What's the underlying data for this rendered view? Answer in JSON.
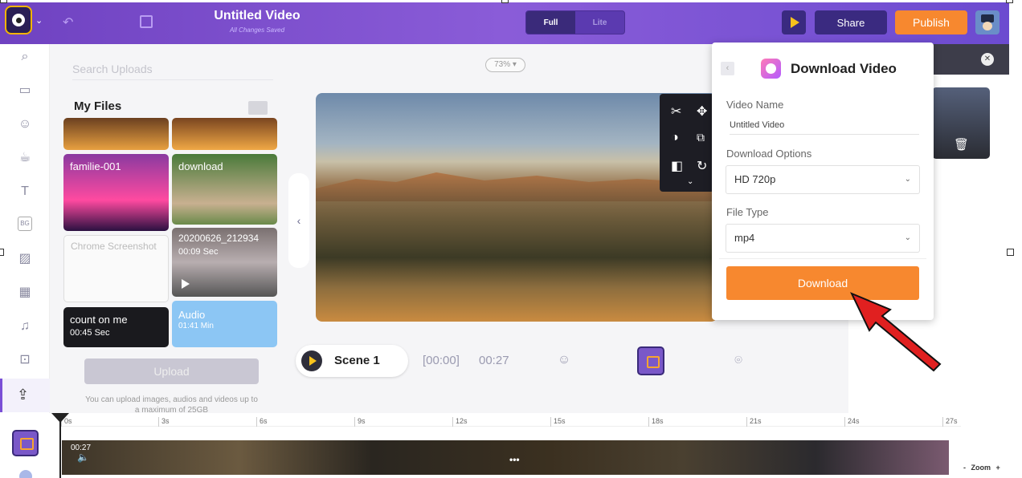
{
  "topbar": {
    "title": "Untitled Video",
    "subtitle": "All Changes Saved",
    "mode_full": "Full",
    "mode_lite": "Lite",
    "share_label": "Share",
    "publish_label": "Publish"
  },
  "uploads": {
    "search_placeholder": "Search Uploads",
    "section_title": "My Files",
    "files": [
      {
        "name": "familie-001",
        "duration": ""
      },
      {
        "name": "download",
        "duration": ""
      },
      {
        "name": "Chrome Screenshot",
        "duration": ""
      },
      {
        "name": "20200626_212934",
        "duration": "00:09 Sec"
      },
      {
        "name": "count on me",
        "duration": "00:45 Sec"
      },
      {
        "name": "Audio",
        "duration": "01:41 Min"
      }
    ],
    "upload_button": "Upload",
    "upload_note": "You can upload images, audios and videos up to a maximum of 25GB"
  },
  "canvas": {
    "zoom_level": "73%"
  },
  "download_popup": {
    "title": "Download Video",
    "video_name_label": "Video Name",
    "video_name_value": "Untitled Video",
    "download_options_label": "Download Options",
    "download_option_selected": "HD 720p",
    "file_type_label": "File Type",
    "file_type_selected": "mp4",
    "download_button": "Download"
  },
  "scene": {
    "name": "Scene 1",
    "start_time": "[00:00]",
    "duration": "00:27"
  },
  "timeline": {
    "ticks": [
      "0s",
      "3s",
      "6s",
      "9s",
      "12s",
      "15s",
      "18s",
      "21s",
      "24s",
      "27s"
    ],
    "clip_time": "00:27",
    "zoom_minus": "-",
    "zoom_label": "Zoom",
    "zoom_plus": "+"
  },
  "colors": {
    "accent_purple": "#7a4fd6",
    "orange": "#f7882f",
    "dark_navy": "#3a2a80"
  }
}
